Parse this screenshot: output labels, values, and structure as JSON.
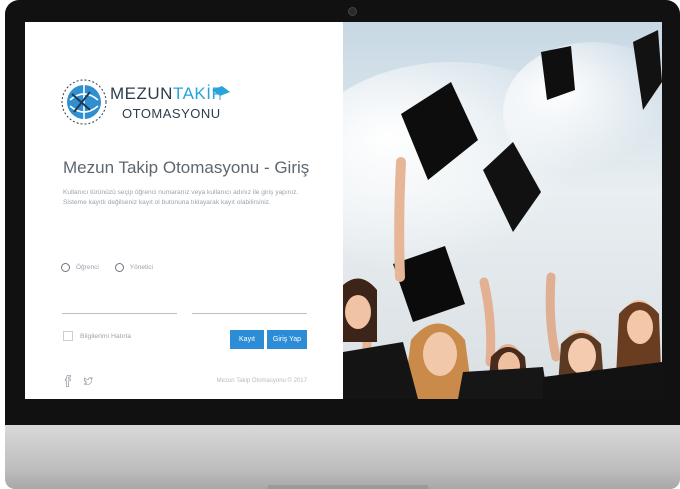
{
  "brand": {
    "name_main": "MEZUN",
    "name_accent": "TAKİP",
    "subtitle": "OTOMASYONU"
  },
  "login": {
    "title": "Mezun Takip Otomasyonu - Giriş",
    "desc_line1": "Kullanıcı türünüzü seçip öğrenci numaranız veya kullanıcı adınız ile giriş yapınız.",
    "desc_line2": "Sisteme kayıtlı değilseniz kayıt ol butonuna tıklayarak kayıt olabilirsiniz.",
    "user_types": [
      "Öğrenci",
      "Yönetici"
    ],
    "username_value": "",
    "password_value": "",
    "remember_label": "Bilgilerimi Hatırla",
    "register_button": "Kayıt Ol",
    "login_button": "Giriş Yap"
  },
  "footer": {
    "copyright": "Mezun Takip Otomasyonu © 2017"
  },
  "icons": {
    "social": [
      "facebook-icon",
      "twitter-icon"
    ],
    "logo": "graduation-cap-globe-logo"
  },
  "colors": {
    "primary_button": "#2c8dd6",
    "brand_accent": "#29a3d9",
    "brand_dark": "#2b3e50"
  }
}
